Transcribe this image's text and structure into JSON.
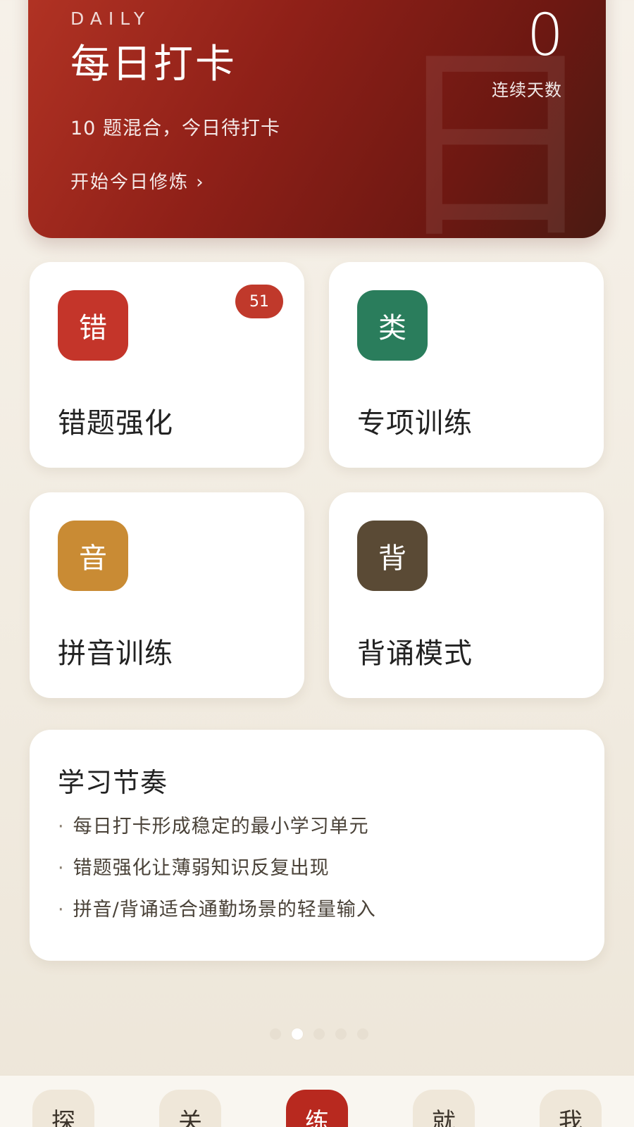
{
  "hero": {
    "eyebrow": "DAILY",
    "title": "每日打卡",
    "subtitle": "10 题混合，今日待打卡",
    "action": "开始今日修炼 ›",
    "streak_value": "0",
    "streak_label": "连续天数",
    "watermark": "日"
  },
  "tiles": [
    {
      "icon": "错",
      "label": "错题强化",
      "color": "#c4352a",
      "badge": "51"
    },
    {
      "icon": "类",
      "label": "专项训练",
      "color": "#2a7d5c"
    },
    {
      "icon": "音",
      "label": "拼音训练",
      "color": "#c98b34"
    },
    {
      "icon": "背",
      "label": "背诵模式",
      "color": "#5a4a35"
    }
  ],
  "rhythm": {
    "title": "学习节奏",
    "items": [
      "每日打卡形成稳定的最小学习单元",
      "错题强化让薄弱知识反复出现",
      "拼音/背诵适合通勤场景的轻量输入"
    ]
  },
  "pager": {
    "count": 5,
    "active_index": 1
  },
  "nav": [
    {
      "label": "探",
      "active": false
    },
    {
      "label": "关",
      "active": false
    },
    {
      "label": "练",
      "active": true
    },
    {
      "label": "就",
      "active": false
    },
    {
      "label": "我",
      "active": false
    }
  ]
}
